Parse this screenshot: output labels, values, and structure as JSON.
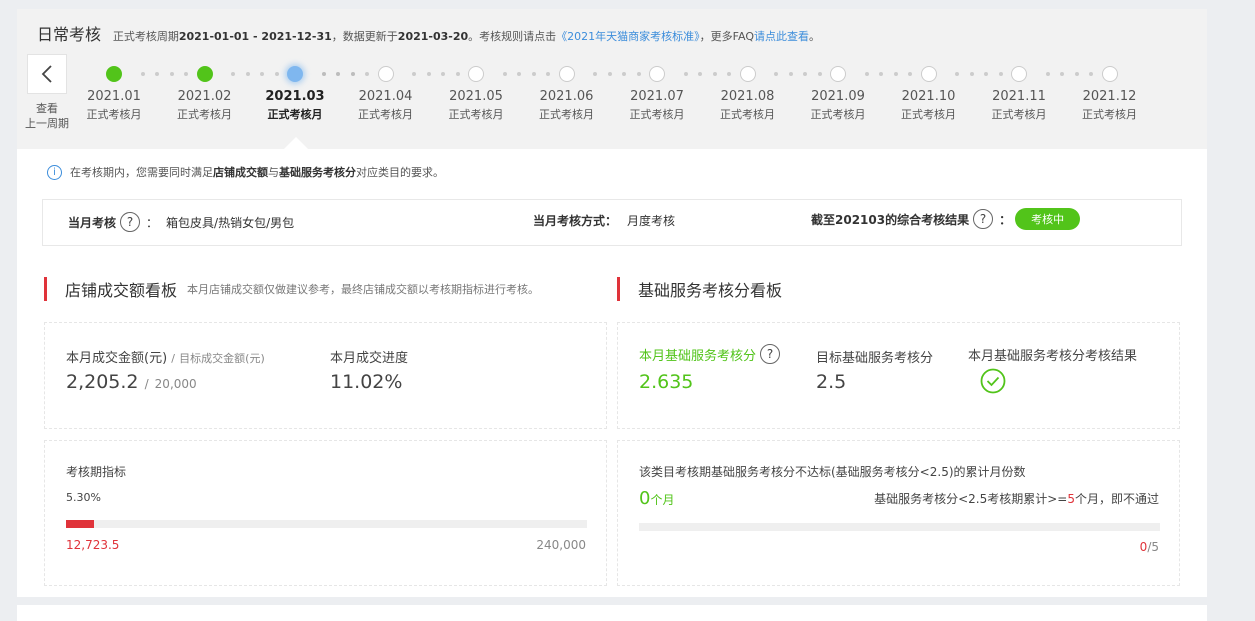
{
  "header": {
    "title": "日常考核",
    "meta_prefix": "正式考核周期",
    "period": "2021-01-01 - 2021-12-31",
    "meta_mid": "，数据更新于",
    "updated": "2021-03-20",
    "meta_rule": "。考核规则请点击",
    "rule_link": "《2021年天猫商家考核标准》",
    "meta_faq": "，更多FAQ",
    "faq_link": "请点此查看",
    "meta_end": "。"
  },
  "prev_period": {
    "label_line1": "查看",
    "label_line2": "上一周期"
  },
  "timeline": [
    {
      "month": "2021.01",
      "label": "正式考核月",
      "state": "done"
    },
    {
      "month": "2021.02",
      "label": "正式考核月",
      "state": "done"
    },
    {
      "month": "2021.03",
      "label": "正式考核月",
      "state": "current"
    },
    {
      "month": "2021.04",
      "label": "正式考核月",
      "state": "future"
    },
    {
      "month": "2021.05",
      "label": "正式考核月",
      "state": "future"
    },
    {
      "month": "2021.06",
      "label": "正式考核月",
      "state": "future"
    },
    {
      "month": "2021.07",
      "label": "正式考核月",
      "state": "future"
    },
    {
      "month": "2021.08",
      "label": "正式考核月",
      "state": "future"
    },
    {
      "month": "2021.09",
      "label": "正式考核月",
      "state": "future"
    },
    {
      "month": "2021.10",
      "label": "正式考核月",
      "state": "future"
    },
    {
      "month": "2021.11",
      "label": "正式考核月",
      "state": "future"
    },
    {
      "month": "2021.12",
      "label": "正式考核月",
      "state": "future"
    }
  ],
  "notice": {
    "pre": "在考核期内，您需要同时满足",
    "b1": "店铺成交额",
    "mid": "与",
    "b2": "基础服务考核分",
    "post": "对应类目的要求。"
  },
  "summary": {
    "month_label": "当月考核",
    "month_colon": "：",
    "category": "箱包皮具/热销女包/男包",
    "method_label": "当月考核方式：",
    "method_value": "月度考核",
    "result_label": "截至202103的综合考核结果",
    "result_colon": "：",
    "result_value": "考核中"
  },
  "gmv_section": {
    "title": "店铺成交额看板",
    "desc": "本月店铺成交额仅做建议参考，最终店铺成交额以考核期指标进行考核。",
    "month_amount_label": "本月成交金额(元)",
    "slash": "/",
    "target_amount_label": "目标成交金额(元)",
    "month_amount": "2,205.2",
    "target_amount": "20,000",
    "progress_label": "本月成交进度",
    "progress_value": "11.02%",
    "period_label": "考核期指标",
    "period_pct": "5.30%",
    "period_fraction": 0.053,
    "period_current": "12,723.5",
    "period_target": "240,000"
  },
  "service_section": {
    "title": "基础服务考核分看板",
    "score_label": "本月基础服务考核分",
    "score_value": "2.635",
    "target_label": "目标基础服务考核分",
    "target_value": "2.5",
    "result_label": "本月基础服务考核分考核结果",
    "fail_desc": "该类目考核期基础服务考核分不达标(基础服务考核分<2.5)的累计月份数",
    "fail_count": "0",
    "fail_unit": "个月",
    "rule_pre": "基础服务考核分<2.5考核期累计>=",
    "rule_num": "5",
    "rule_post": "个月，即不通过",
    "count_current": "0",
    "count_sep": "/",
    "count_total": "5",
    "count_fraction": 0
  },
  "colors": {
    "green": "#52c41a",
    "red": "#e0333a",
    "blue": "#3c8ddb",
    "current_dot": "#7fb7ef"
  }
}
